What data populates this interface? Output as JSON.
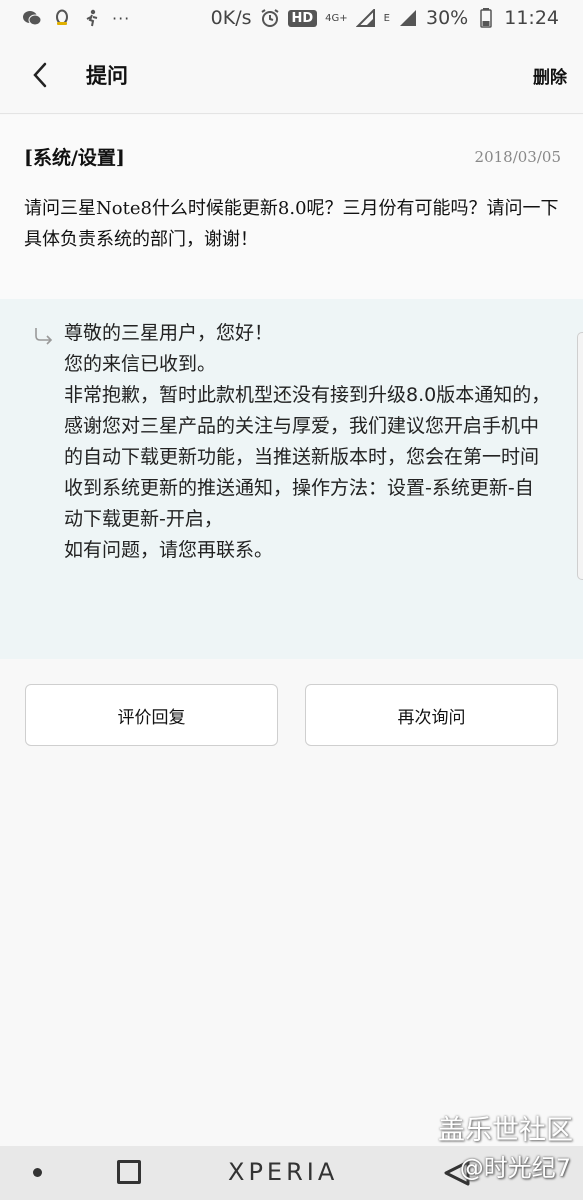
{
  "status_bar": {
    "speed": "0K/s",
    "hd": "HD",
    "network": "4G+",
    "network_e": "E",
    "battery": "30%",
    "time": "11:24",
    "more": "···"
  },
  "header": {
    "title": "提问",
    "delete_label": "删除"
  },
  "question": {
    "category": "[系统/设置]",
    "date": "2018/03/05",
    "text": "请问三星Note8什么时候能更新8.0呢？三月份有可能吗？请问一下具体负责系统的部门，谢谢！"
  },
  "answer": {
    "lines": [
      "尊敬的三星用户，您好！",
      "您的来信已收到。",
      "非常抱歉，暂时此款机型还没有接到升级8.0版本通知的，感谢您对三星产品的关注与厚爱，我们建议您开启手机中的自动下载更新功能，当推送新版本时，您会在第一时间收到系统更新的推送通知，操作方法：设置-系统更新-自动下载更新-开启，",
      "如有问题，请您再联系。"
    ]
  },
  "buttons": {
    "rate_label": "评价回复",
    "ask_again_label": "再次询问"
  },
  "watermark": {
    "site": "盖乐世社区",
    "user": "@时光纪7"
  },
  "nav_bar": {
    "brand": "XPERIA"
  }
}
